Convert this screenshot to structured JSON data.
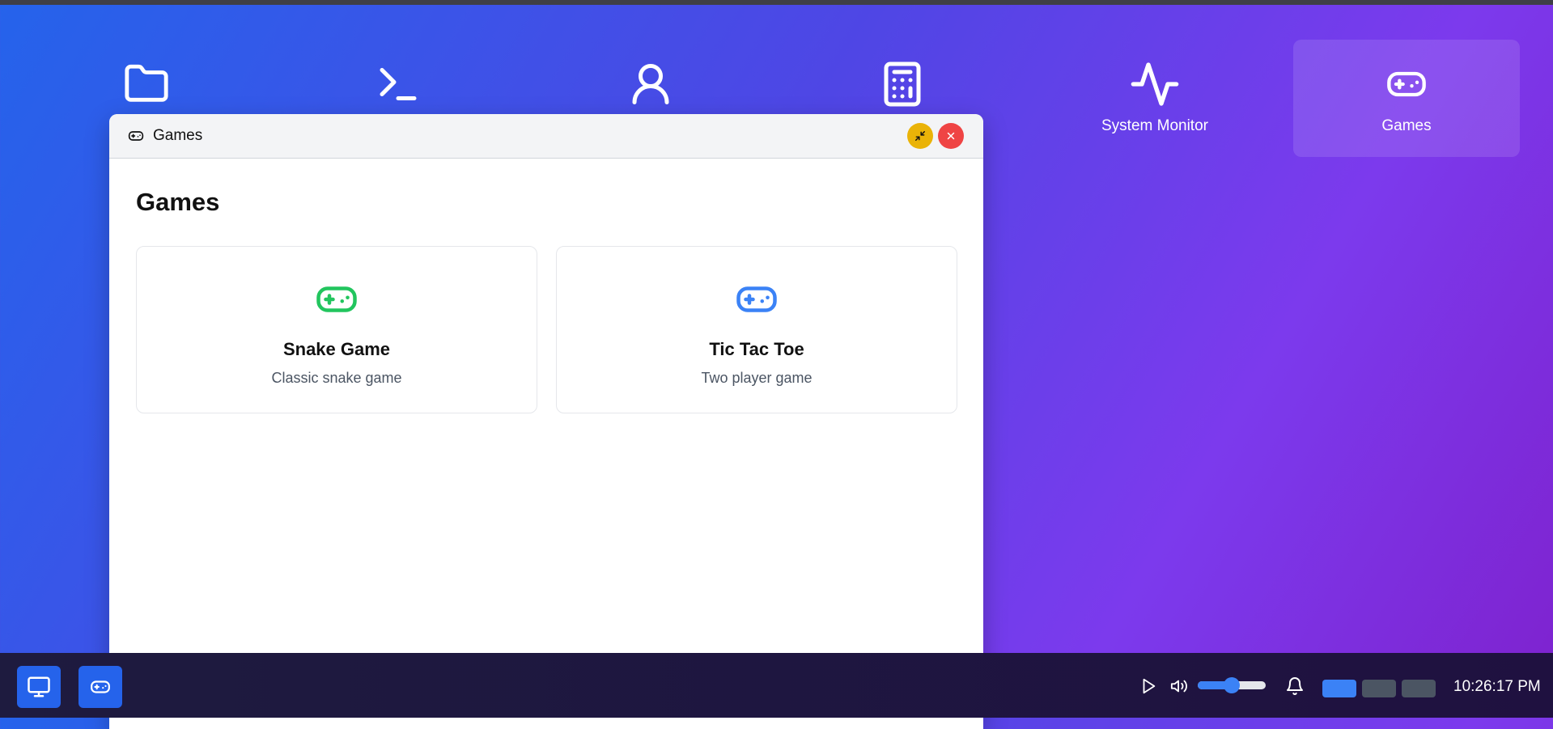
{
  "desktop": {
    "icons": [
      {
        "name": "folder-icon",
        "label": ""
      },
      {
        "name": "terminal-icon",
        "label": ""
      },
      {
        "name": "user-icon",
        "label": ""
      },
      {
        "name": "calculator-icon",
        "label": ""
      },
      {
        "name": "activity-icon",
        "label": "System Monitor"
      },
      {
        "name": "gamepad-icon",
        "label": "Games",
        "selected": true
      }
    ]
  },
  "window": {
    "title": "Games",
    "heading": "Games",
    "games": [
      {
        "name": "Snake Game",
        "description": "Classic snake game",
        "icon_color": "#22c55e"
      },
      {
        "name": "Tic Tac Toe",
        "description": "Two player game",
        "icon_color": "#3b82f6"
      }
    ]
  },
  "taskbar": {
    "volume_level": 0.5,
    "workspaces": [
      {
        "active": true,
        "color": "#3b82f6"
      },
      {
        "active": false,
        "color": "#4b5563"
      },
      {
        "active": false,
        "color": "#4b5563"
      }
    ],
    "clock": "10:26:17 PM"
  },
  "colors": {
    "accent": "#2563eb",
    "minimize": "#eab308",
    "close": "#ef4444"
  }
}
